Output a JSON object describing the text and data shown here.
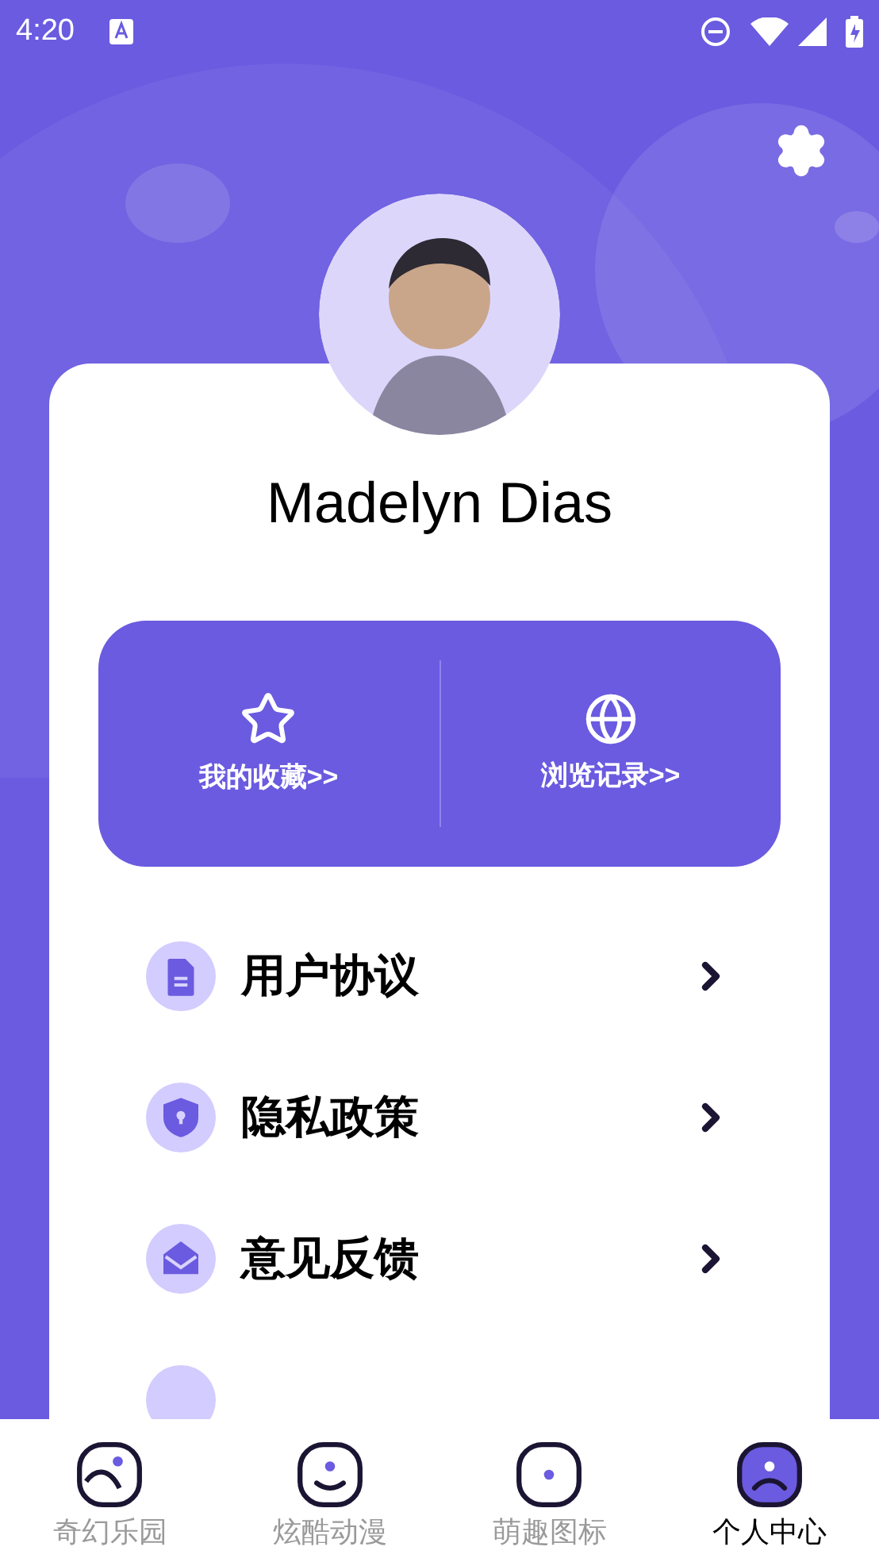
{
  "status_bar": {
    "time": "4:20"
  },
  "profile": {
    "name": "Madelyn Dias"
  },
  "quick_actions": [
    {
      "kind": "star",
      "label": "我的收藏>>"
    },
    {
      "kind": "globe",
      "label": "浏览记录>>"
    }
  ],
  "menu": [
    {
      "kind": "document",
      "label": "用户协议"
    },
    {
      "kind": "shield",
      "label": "隐私政策"
    },
    {
      "kind": "mail",
      "label": "意见反馈"
    }
  ],
  "tabs": [
    {
      "kind": "landscape",
      "label": "奇幻乐园",
      "selected": false
    },
    {
      "kind": "smile",
      "label": "炫酷动漫",
      "selected": false
    },
    {
      "kind": "dot",
      "label": "萌趣图标",
      "selected": false
    },
    {
      "kind": "frown",
      "label": "个人中心",
      "selected": true
    }
  ]
}
